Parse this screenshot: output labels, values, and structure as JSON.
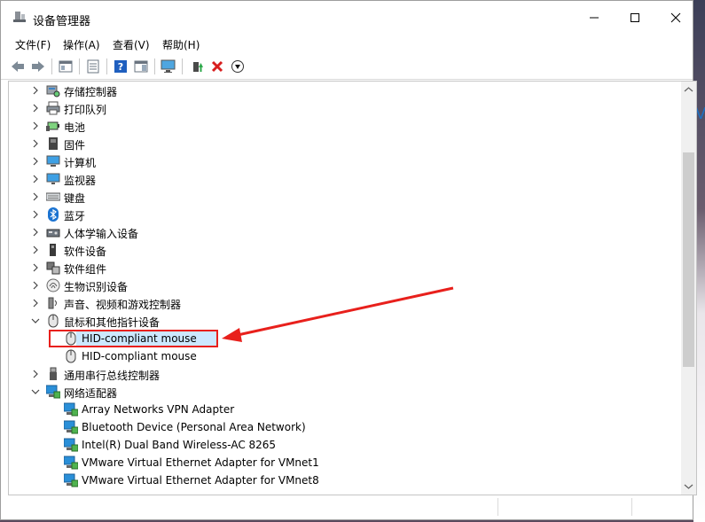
{
  "window": {
    "title": "设备管理器"
  },
  "menu": [
    "文件(F)",
    "操作(A)",
    "查看(V)",
    "帮助(H)"
  ],
  "toolbar": {
    "buttons": [
      "back-icon",
      "forward-icon",
      "show-hide-console-tree-icon",
      "properties-icon",
      "help-icon",
      "action-pane-icon",
      "monitor-icon",
      "update-driver-icon",
      "uninstall-icon",
      "disable-icon"
    ]
  },
  "tree": {
    "items": [
      {
        "label": "存储控制器",
        "icon": "storage-controller-icon",
        "level": 0,
        "expander": "collapsed"
      },
      {
        "label": "打印队列",
        "icon": "printer-icon",
        "level": 0,
        "expander": "collapsed"
      },
      {
        "label": "电池",
        "icon": "battery-icon",
        "level": 0,
        "expander": "collapsed"
      },
      {
        "label": "固件",
        "icon": "firmware-icon",
        "level": 0,
        "expander": "collapsed"
      },
      {
        "label": "计算机",
        "icon": "computer-icon",
        "level": 0,
        "expander": "collapsed"
      },
      {
        "label": "监视器",
        "icon": "monitor-icon",
        "level": 0,
        "expander": "collapsed"
      },
      {
        "label": "键盘",
        "icon": "keyboard-icon",
        "level": 0,
        "expander": "collapsed"
      },
      {
        "label": "蓝牙",
        "icon": "bluetooth-icon",
        "level": 0,
        "expander": "collapsed"
      },
      {
        "label": "人体学输入设备",
        "icon": "hid-icon",
        "level": 0,
        "expander": "collapsed"
      },
      {
        "label": "软件设备",
        "icon": "software-device-icon",
        "level": 0,
        "expander": "collapsed"
      },
      {
        "label": "软件组件",
        "icon": "software-component-icon",
        "level": 0,
        "expander": "collapsed"
      },
      {
        "label": "生物识别设备",
        "icon": "fingerprint-icon",
        "level": 0,
        "expander": "collapsed"
      },
      {
        "label": "声音、视频和游戏控制器",
        "icon": "speaker-icon",
        "level": 0,
        "expander": "collapsed"
      },
      {
        "label": "鼠标和其他指针设备",
        "icon": "mouse-icon",
        "level": 0,
        "expander": "expanded"
      },
      {
        "label": "HID-compliant mouse",
        "icon": "mouse-icon",
        "level": 1,
        "selected": true
      },
      {
        "label": "HID-compliant mouse",
        "icon": "mouse-icon",
        "level": 1
      },
      {
        "label": "通用串行总线控制器",
        "icon": "usb-icon",
        "level": 0,
        "expander": "collapsed"
      },
      {
        "label": "网络适配器",
        "icon": "network-adapter-icon",
        "level": 0,
        "expander": "expanded"
      },
      {
        "label": "Array Networks VPN Adapter",
        "icon": "network-adapter-icon",
        "level": 1
      },
      {
        "label": "Bluetooth Device (Personal Area Network)",
        "icon": "network-adapter-icon",
        "level": 1
      },
      {
        "label": "Intel(R) Dual Band Wireless-AC 8265",
        "icon": "network-adapter-icon",
        "level": 1
      },
      {
        "label": "VMware Virtual Ethernet Adapter for VMnet1",
        "icon": "network-adapter-icon",
        "level": 1
      },
      {
        "label": "VMware Virtual Ethernet Adapter for VMnet8",
        "icon": "network-adapter-icon",
        "level": 1
      }
    ]
  },
  "colors": {
    "selection": "#cce8ff",
    "annotation": "#e8201c",
    "network_blue": "#2a8fd8"
  }
}
